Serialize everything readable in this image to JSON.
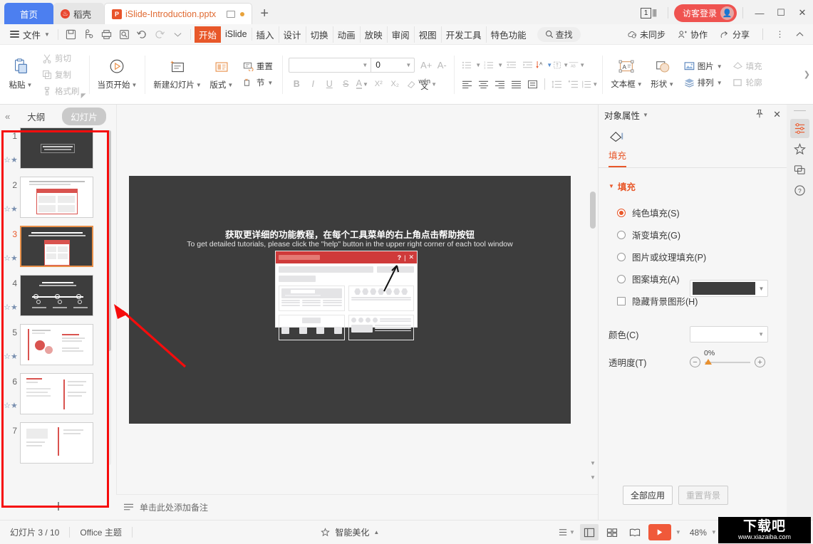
{
  "titlebar": {
    "tabs": [
      {
        "label": "首页",
        "icon": "home-icon"
      },
      {
        "label": "稻壳",
        "icon": "docer-icon"
      },
      {
        "label": "iSlide-Introduction.pptx",
        "icon": "powerpoint-icon"
      }
    ],
    "new_tab_label": "+",
    "page_badge": "1",
    "login_label": "访客登录",
    "minimize": "—",
    "maximize": "☐",
    "close": "✕"
  },
  "menubar": {
    "file_label": "文件",
    "quick_icons": [
      "save-icon",
      "save-as-icon",
      "print-icon",
      "print-preview-icon",
      "undo-icon",
      "redo-icon",
      "customize-qat-icon"
    ],
    "tabs": [
      {
        "label": "开始",
        "selected": true
      },
      {
        "label": "iSlide",
        "selected": false
      },
      {
        "label": "插入",
        "selected": false
      },
      {
        "label": "设计",
        "selected": false
      },
      {
        "label": "切换",
        "selected": false
      },
      {
        "label": "动画",
        "selected": false
      },
      {
        "label": "放映",
        "selected": false
      },
      {
        "label": "审阅",
        "selected": false
      },
      {
        "label": "视图",
        "selected": false
      },
      {
        "label": "开发工具",
        "selected": false
      },
      {
        "label": "特色功能",
        "selected": false
      }
    ],
    "find_label": "查找",
    "right_items": [
      {
        "label": "未同步",
        "icon": "cloud-sync-icon"
      },
      {
        "label": "协作",
        "icon": "collaborate-icon"
      },
      {
        "label": "分享",
        "icon": "share-icon"
      }
    ],
    "more_icon": "more-vertical-icon",
    "collapse_icon": "chevron-up-icon"
  },
  "ribbon": {
    "clipboard": {
      "paste_label": "粘贴",
      "cut_label": "剪切",
      "copy_label": "复制",
      "format_painter_label": "格式刷"
    },
    "present": {
      "start_here_label": "当页开始"
    },
    "slides": {
      "new_slide_label": "新建幻灯片",
      "layout_label": "版式",
      "reset_label": "重置",
      "section_label": "节"
    },
    "font": {
      "font_name_value": "",
      "font_size_value": "0",
      "grow_font": "A+",
      "shrink_font": "A-",
      "bold": "B",
      "italic": "I",
      "underline": "U",
      "strikethrough": "S",
      "font_color": "A",
      "superscript": "X²",
      "subscript": "X₂",
      "clear_format": "clear-format-icon",
      "phonetic": "wén"
    },
    "paragraph": {
      "bullets": "bullet-list-icon",
      "numbering": "numbered-list-icon",
      "decrease_indent": "decrease-indent-icon",
      "increase_indent": "increase-indent-icon",
      "text_direction": "text-direction-icon",
      "align_text": "align-text-icon",
      "smartart": "smartart-icon",
      "align_left": "align-left-icon",
      "align_center": "align-center-icon",
      "align_right": "align-right-icon",
      "justify": "justify-icon",
      "distribute": "distribute-icon",
      "line_spacing": "line-spacing-icon",
      "para_spacing": "para-spacing-icon",
      "columns": "columns-icon"
    },
    "drawing": {
      "textbox_label": "文本框",
      "shape_label": "形状",
      "picture_label": "图片",
      "arrange_label": "排列",
      "fill_label": "填充",
      "outline_label": "轮廓"
    },
    "overflow_icon": "chevron-right-icon"
  },
  "left_panel": {
    "collapse_icon": "double-chevron-left-icon",
    "tab_outline": "大纲",
    "tab_slides": "幻灯片",
    "slides": [
      {
        "number": "1",
        "selected": false,
        "theme": "dark",
        "kind": "title"
      },
      {
        "number": "2",
        "selected": false,
        "theme": "light",
        "kind": "panel"
      },
      {
        "number": "3",
        "selected": true,
        "theme": "dark",
        "kind": "popup"
      },
      {
        "number": "4",
        "selected": false,
        "theme": "dark",
        "kind": "timeline"
      },
      {
        "number": "5",
        "selected": false,
        "theme": "light",
        "kind": "chart"
      },
      {
        "number": "6",
        "selected": false,
        "theme": "light",
        "kind": "table"
      },
      {
        "number": "7",
        "selected": false,
        "theme": "light",
        "kind": "mixed"
      }
    ],
    "add_slide_icon": "plus-icon"
  },
  "slide": {
    "title_cn": "获取更详细的功能教程，在每个工具菜单的右上角点击帮助按钮",
    "subtitle_en": "To get detailed tutorials, please click the \"help\" button in the upper right corner of each tool window",
    "popup": {
      "help_icon": "question-mark-icon",
      "divider": "|",
      "close_icon": "close-icon"
    }
  },
  "notes": {
    "icon": "notes-icon",
    "placeholder": "单击此处添加备注"
  },
  "right_panel": {
    "title": "对象属性",
    "dropdown_icon": "chevron-down-icon",
    "pin_icon": "pin-icon",
    "close_icon": "close-icon",
    "shape_icon": "shape-fill-icon",
    "tab_fill": "填充",
    "section_fill": "填充",
    "fill_color_hex": "#3d3d3d",
    "options": [
      {
        "label": "纯色填充(S)",
        "type": "radio",
        "checked": true
      },
      {
        "label": "渐变填充(G)",
        "type": "radio",
        "checked": false
      },
      {
        "label": "图片或纹理填充(P)",
        "type": "radio",
        "checked": false
      },
      {
        "label": "图案填充(A)",
        "type": "radio",
        "checked": false
      },
      {
        "label": "隐藏背景图形(H)",
        "type": "checkbox",
        "checked": false
      }
    ],
    "color_label": "颜色(C)",
    "color_value": "",
    "transparency_label": "透明度(T)",
    "transparency_value": "0%",
    "apply_all_label": "全部应用",
    "reset_bg_label": "重置背景"
  },
  "rail": {
    "items": [
      {
        "icon": "object-properties-icon",
        "selected": true
      },
      {
        "icon": "effects-icon",
        "selected": false
      },
      {
        "icon": "selection-pane-icon",
        "selected": false
      },
      {
        "icon": "help-icon",
        "selected": false
      }
    ]
  },
  "status": {
    "slide_count": "幻灯片 3 / 10",
    "theme": "Office 主题",
    "beautify_label": "智能美化",
    "beautify_icon": "magic-wand-icon",
    "beautify_caret": "▲",
    "view_icons": [
      "reading-layout-icon",
      "normal-view-icon",
      "slide-sorter-icon",
      "reading-view-icon"
    ],
    "play_icon": "play-icon",
    "zoom_value": "48%",
    "zoom_out": "−",
    "zoom_in": "+"
  },
  "watermark": {
    "big": "下载吧",
    "small": "www.xiazaiba.com"
  },
  "colors": {
    "accent_orange": "#e8582a",
    "tab_blue": "#4c7ff0",
    "login_red": "#ef5350",
    "slide_bg": "#3d3d3d",
    "highlight_red": "#f60c0c",
    "play_orange": "#f0593a"
  }
}
